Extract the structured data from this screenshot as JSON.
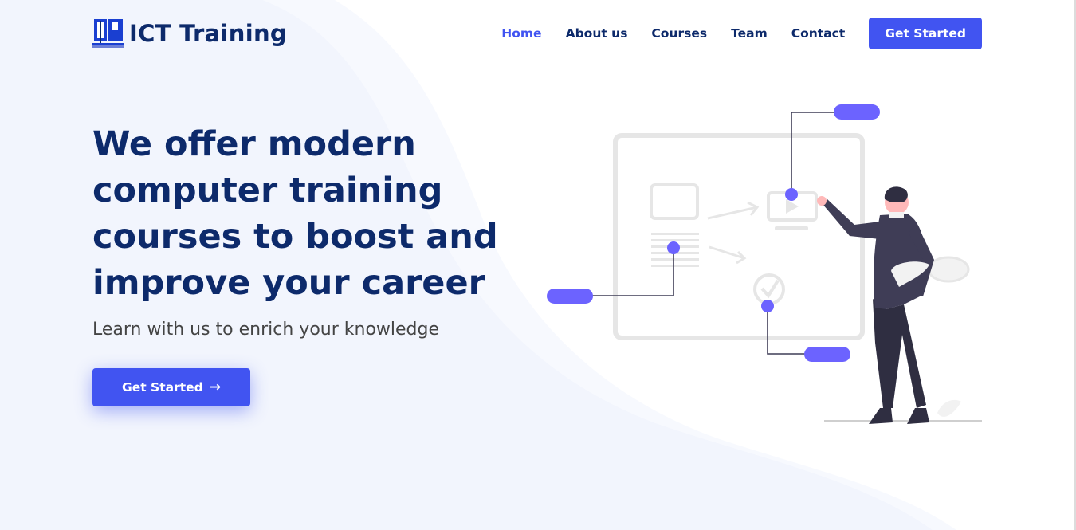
{
  "brand": {
    "logo_icon": "jp-logo-icon",
    "logo_text": "ICT Training"
  },
  "nav": {
    "items": [
      {
        "label": "Home",
        "active": true
      },
      {
        "label": "About us",
        "active": false
      },
      {
        "label": "Courses",
        "active": false
      },
      {
        "label": "Team",
        "active": false
      },
      {
        "label": "Contact",
        "active": false
      }
    ],
    "cta_label": "Get Started"
  },
  "hero": {
    "title": "We offer modern computer training courses to boost and improve your career",
    "subtitle": "Learn with us to enrich your knowledge",
    "button_label": "Get Started",
    "button_icon": "arrow-right-icon"
  },
  "colors": {
    "accent": "#4154f1",
    "heading": "#0d2a6b",
    "body_text": "#444444",
    "illustration_accent": "#6c63ff",
    "background_wave": "#f0f3fd"
  }
}
